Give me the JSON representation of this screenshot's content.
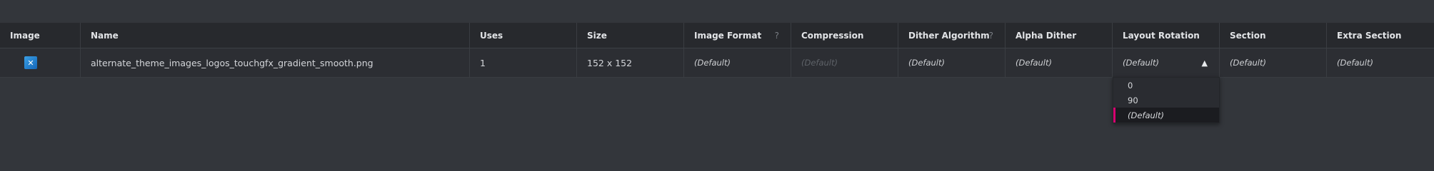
{
  "headers": {
    "image": "Image",
    "name": "Name",
    "uses": "Uses",
    "size": "Size",
    "image_format": "Image Format",
    "image_format_help": "?",
    "compression": "Compression",
    "dither_algorithm": "Dither Algorithm",
    "dither_algorithm_help": "?",
    "alpha_dither": "Alpha Dither",
    "layout_rotation": "Layout Rotation",
    "section": "Section",
    "extra_section": "Extra Section"
  },
  "row": {
    "thumbnail_icon": "x-logo-icon",
    "name": "alternate_theme_images_logos_touchgfx_gradient_smooth.png",
    "uses": "1",
    "size": "152 x 152",
    "image_format": "(Default)",
    "compression": "(Default)",
    "dither_algorithm": "(Default)",
    "alpha_dither": "(Default)",
    "layout_rotation": "(Default)",
    "section": "(Default)",
    "extra_section": "(Default)"
  },
  "layout_rotation_dropdown": {
    "options": [
      "0",
      "90",
      "(Default)"
    ],
    "selected": "(Default)"
  },
  "colors": {
    "accent": "#d6006f",
    "background": "#33363b",
    "header_bg": "#27292d",
    "row_bg": "#2c2e33"
  }
}
